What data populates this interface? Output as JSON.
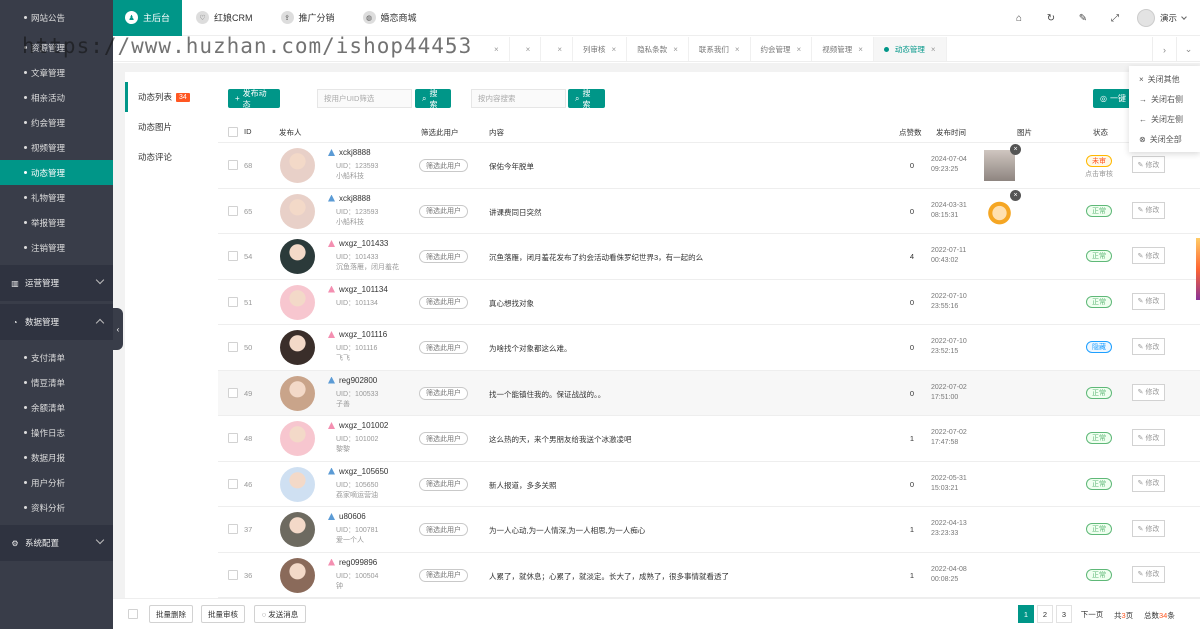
{
  "watermark": "https://www.huzhan.com/ishop44453",
  "sidebar": {
    "top_items": [
      "网站公告",
      "资源管理",
      "文章管理",
      "相亲活动",
      "约会管理",
      "视频管理",
      "动态管理",
      "礼物管理",
      "举报管理",
      "注销管理"
    ],
    "active": "动态管理",
    "groups": {
      "ops": "运营管理",
      "data": "数据管理",
      "sys": "系统配置"
    },
    "data_items": [
      "支付清单",
      "情豆清单",
      "余额清单",
      "操作日志",
      "数据月报",
      "用户分析",
      "资料分析"
    ]
  },
  "topnav": {
    "items": [
      "主后台",
      "红娘CRM",
      "推广分销",
      "婚恋商城"
    ],
    "active": "主后台",
    "user": "演示"
  },
  "tabs": [
    "",
    "",
    "",
    "列审核",
    "隐私条款",
    "联系我们",
    "约会管理",
    "视频管理",
    "动态管理"
  ],
  "active_tab": "动态管理",
  "context_menu": [
    "关闭其他",
    "关闭右侧",
    "关闭左侧",
    "关闭全部"
  ],
  "subnav": {
    "items": [
      "动态列表",
      "动态图片",
      "动态评论"
    ],
    "badge": "34"
  },
  "toolbar": {
    "publish": "发布动态",
    "uid_placeholder": "按用户UID筛选",
    "search": "搜索",
    "content_placeholder": "按内容搜索",
    "search2": "搜索",
    "batch": "一键"
  },
  "table": {
    "headers": {
      "id": "ID",
      "author": "发布人",
      "filter": "筛选此用户",
      "content": "内容",
      "clicks": "点赞数",
      "time": "发布时间",
      "image": "图片",
      "status": "状态"
    },
    "filter_label": "筛选此用户",
    "edit_label": "修改",
    "uid_prefix": "UID：",
    "rows": [
      {
        "id": "68",
        "name": "xckj8888",
        "uid": "123593",
        "extra": "小船科技",
        "gender": "male",
        "content": "保佑今年脱单",
        "clicks": "0",
        "date": "2024-07-04",
        "clock": "09:23:25",
        "status": "未审",
        "status_type": "pending",
        "audit": "点击审核",
        "has_thumb": true,
        "thumb": "photo",
        "photo": "#e8d0c8"
      },
      {
        "id": "65",
        "name": "xckj8888",
        "uid": "123593",
        "extra": "小船科技",
        "gender": "male",
        "content": "讲课费同日突然",
        "clicks": "0",
        "date": "2024-03-31",
        "clock": "08:15:31",
        "status": "正常",
        "status_type": "ok",
        "has_thumb": true,
        "thumb": "cartoon",
        "photo": "#e8d0c8"
      },
      {
        "id": "54",
        "name": "wxgz_101433",
        "uid": "101433",
        "extra": "沉鱼落雁，闭月羞花",
        "gender": "female",
        "content": "沉鱼落雁，闭月羞花发布了约会活动看侏罗纪世界3，有一起的么",
        "clicks": "4",
        "date": "2022-07-11",
        "clock": "00:43:02",
        "status": "正常",
        "status_type": "ok",
        "photo": "#2b3a3a"
      },
      {
        "id": "51",
        "name": "wxgz_101134",
        "uid": "101134",
        "extra": "",
        "gender": "female",
        "content": "真心想找对象",
        "clicks": "0",
        "date": "2022-07-10",
        "clock": "23:55:16",
        "status": "正常",
        "status_type": "ok",
        "photo": "#f7c6cf"
      },
      {
        "id": "50",
        "name": "wxgz_101116",
        "uid": "101116",
        "extra": "飞飞",
        "gender": "female",
        "content": "为啥找个对象都这么难。",
        "clicks": "0",
        "date": "2022-07-10",
        "clock": "23:52:15",
        "status": "隐藏",
        "status_type": "hidden",
        "photo": "#3a2e2a"
      },
      {
        "id": "49",
        "name": "reg902800",
        "uid": "100533",
        "extra": "子善",
        "gender": "male",
        "content": "找一个能镇住我的。保证战战的。。",
        "clicks": "0",
        "date": "2022-07-02",
        "clock": "17:51:00",
        "status": "正常",
        "status_type": "ok",
        "photo": "#c9a48a"
      },
      {
        "id": "48",
        "name": "wxgz_101002",
        "uid": "101002",
        "extra": "黎黎",
        "gender": "female",
        "content": "这么热的天，来个男朋友给我送个冰激凌吧",
        "clicks": "1",
        "date": "2022-07-02",
        "clock": "17:47:58",
        "status": "正常",
        "status_type": "ok",
        "photo": "#f7c6cf"
      },
      {
        "id": "46",
        "name": "wxgz_105650",
        "uid": "105650",
        "extra": "荔家嘀运营油",
        "gender": "male",
        "content": "新人报道，多多关照",
        "clicks": "0",
        "date": "2022-05-31",
        "clock": "15:03:21",
        "status": "正常",
        "status_type": "ok",
        "photo": "#cfe0f2"
      },
      {
        "id": "37",
        "name": "u80606",
        "uid": "100781",
        "extra": "爱一个人",
        "gender": "male",
        "content": "为一人心动,为一人情深,为一人相思,为一人痴心",
        "clicks": "1",
        "date": "2022-04-13",
        "clock": "23:23:33",
        "status": "正常",
        "status_type": "ok",
        "photo": "#6d6a60"
      },
      {
        "id": "36",
        "name": "reg099896",
        "uid": "100504",
        "extra": "钟",
        "gender": "female",
        "content": "人累了，就休息；心累了，就淡定。长大了，成熟了，很多事情就看透了",
        "clicks": "1",
        "date": "2022-04-08",
        "clock": "00:08:25",
        "status": "正常",
        "status_type": "ok",
        "photo": "#8a6a5a"
      }
    ]
  },
  "footer": {
    "batch_delete": "批量删除",
    "batch_audit": "批量审核",
    "send_msg": "发送消息",
    "pages": [
      "1",
      "2",
      "3"
    ],
    "next": "下一页",
    "total_pages_pre": "共",
    "total_pages": "3",
    "total_pages_suf": "页",
    "total_pre": "总数",
    "total": "34",
    "total_suf": "条"
  }
}
